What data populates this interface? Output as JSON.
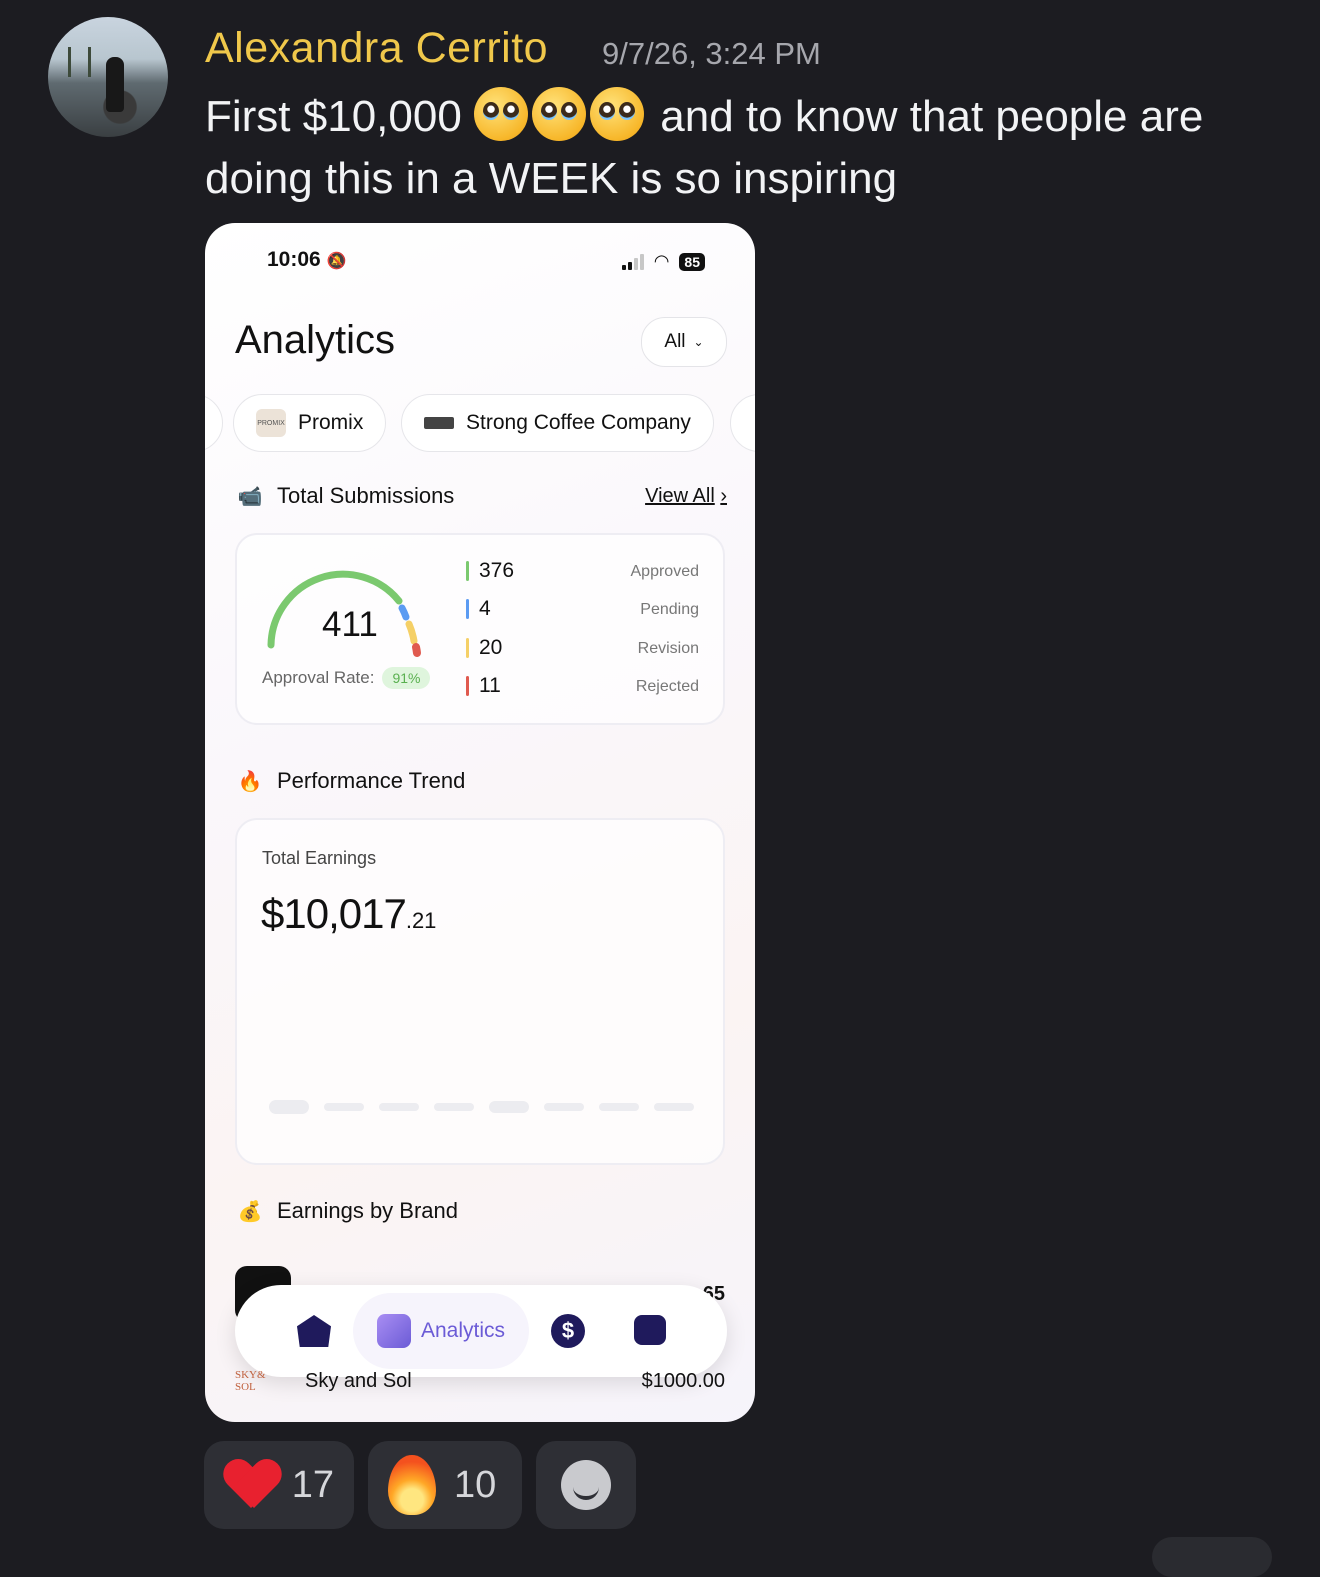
{
  "message": {
    "author": "Alexandra Cerrito",
    "timestamp": "9/7/26, 3:24 PM",
    "text_before": "First $10,000",
    "text_after": "and to know that people are doing this in a WEEK is so inspiring",
    "emoji": "pleading-face",
    "emoji_count": 3
  },
  "phone": {
    "status": {
      "time": "10:06",
      "battery": "85"
    },
    "title": "Analytics",
    "filter": "All",
    "chips": [
      "Promix",
      "Strong Coffee Company"
    ],
    "submissions": {
      "title": "Total Submissions",
      "view_all": "View All",
      "total": "411",
      "approval_label": "Approval Rate:",
      "approval_rate": "91%",
      "stats": [
        {
          "value": "376",
          "label": "Approved",
          "color": "#7bc96f"
        },
        {
          "value": "4",
          "label": "Pending",
          "color": "#5b9bf2"
        },
        {
          "value": "20",
          "label": "Revision",
          "color": "#f5d067"
        },
        {
          "value": "11",
          "label": "Rejected",
          "color": "#e05a4f"
        }
      ]
    },
    "performance": {
      "title": "Performance Trend",
      "earnings_label": "Total Earnings",
      "earnings_main": "$10,017",
      "earnings_cents": ".21"
    },
    "earnings_by_brand": {
      "title": "Earnings by Brand",
      "rows": [
        {
          "name": "Sky and Sol",
          "amount": "$1000.00"
        }
      ],
      "partial_amount": "65"
    },
    "nav": {
      "active": "Analytics"
    }
  },
  "reactions": [
    {
      "emoji": "heart",
      "count": "17"
    },
    {
      "emoji": "fire",
      "count": "10"
    }
  ]
}
